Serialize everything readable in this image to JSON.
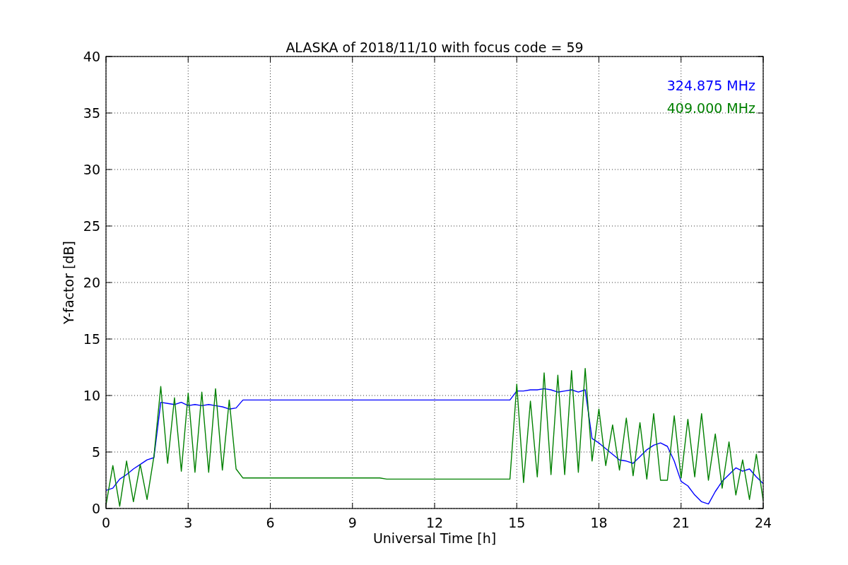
{
  "chart_data": {
    "type": "line",
    "grid": true,
    "title": "ALASKA of 2018/11/10 with focus code = 59",
    "xlabel": "Universal Time [h]",
    "ylabel": "Y-factor [dB]",
    "xlim": [
      0,
      24
    ],
    "ylim": [
      0,
      40
    ],
    "xticks": [
      0,
      3,
      6,
      9,
      12,
      15,
      18,
      21,
      24
    ],
    "yticks": [
      0,
      5,
      10,
      15,
      20,
      25,
      30,
      35,
      40
    ],
    "x": [
      0,
      0.25,
      0.5,
      0.75,
      1,
      1.25,
      1.5,
      1.75,
      2,
      2.25,
      2.5,
      2.75,
      3,
      3.25,
      3.5,
      3.75,
      4,
      4.25,
      4.5,
      4.75,
      5,
      5.25,
      5.5,
      5.75,
      6,
      6.25,
      6.5,
      6.75,
      7,
      7.25,
      7.5,
      7.75,
      8,
      8.25,
      8.5,
      8.75,
      9,
      9.25,
      9.5,
      9.75,
      10,
      10.25,
      10.5,
      10.75,
      11,
      11.25,
      11.5,
      11.75,
      12,
      12.25,
      12.5,
      12.75,
      13,
      13.25,
      13.5,
      13.75,
      14,
      14.25,
      14.5,
      14.75,
      15,
      15.25,
      15.5,
      15.75,
      16,
      16.25,
      16.5,
      16.75,
      17,
      17.25,
      17.5,
      17.75,
      18,
      18.25,
      18.5,
      18.75,
      19,
      19.25,
      19.5,
      19.75,
      20,
      20.25,
      20.5,
      20.75,
      21,
      21.25,
      21.5,
      21.75,
      22,
      22.25,
      22.5,
      22.75,
      23,
      23.25,
      23.5,
      23.75,
      24
    ],
    "series": [
      {
        "name": "324.875 MHz",
        "color": "#0000ff",
        "values": [
          1.6,
          1.8,
          2.6,
          3.0,
          3.5,
          3.9,
          4.3,
          4.5,
          9.4,
          9.3,
          9.2,
          9.4,
          9.1,
          9.2,
          9.1,
          9.2,
          9.1,
          9.0,
          8.8,
          8.9,
          9.6,
          9.6,
          9.6,
          9.6,
          9.6,
          9.6,
          9.6,
          9.6,
          9.6,
          9.6,
          9.6,
          9.6,
          9.6,
          9.6,
          9.6,
          9.6,
          9.6,
          9.6,
          9.6,
          9.6,
          9.6,
          9.6,
          9.6,
          9.6,
          9.6,
          9.6,
          9.6,
          9.6,
          9.6,
          9.6,
          9.6,
          9.6,
          9.6,
          9.6,
          9.6,
          9.6,
          9.6,
          9.6,
          9.6,
          9.6,
          10.4,
          10.4,
          10.5,
          10.5,
          10.6,
          10.5,
          10.3,
          10.4,
          10.5,
          10.3,
          10.5,
          6.2,
          5.8,
          5.3,
          4.8,
          4.3,
          4.2,
          4.0,
          4.6,
          5.2,
          5.6,
          5.8,
          5.5,
          4.2,
          2.4,
          2.0,
          1.2,
          0.6,
          0.4,
          1.5,
          2.4,
          3.0,
          3.6,
          3.3,
          3.5,
          2.8,
          2.2
        ]
      },
      {
        "name": "409.000 MHz",
        "color": "#008000",
        "values": [
          0.3,
          3.8,
          0.2,
          4.2,
          0.6,
          3.9,
          0.8,
          4.6,
          10.8,
          4.0,
          9.8,
          3.3,
          10.2,
          3.2,
          10.3,
          3.2,
          10.6,
          3.4,
          9.6,
          3.5,
          2.7,
          2.7,
          2.7,
          2.7,
          2.7,
          2.7,
          2.7,
          2.7,
          2.7,
          2.7,
          2.7,
          2.7,
          2.7,
          2.7,
          2.7,
          2.7,
          2.7,
          2.7,
          2.7,
          2.7,
          2.7,
          2.6,
          2.6,
          2.6,
          2.6,
          2.6,
          2.6,
          2.6,
          2.6,
          2.6,
          2.6,
          2.6,
          2.6,
          2.6,
          2.6,
          2.6,
          2.6,
          2.6,
          2.6,
          2.6,
          11.0,
          2.3,
          9.5,
          2.8,
          12.0,
          3.0,
          11.8,
          3.0,
          12.2,
          3.2,
          12.4,
          4.2,
          8.8,
          3.8,
          7.4,
          3.4,
          8.0,
          2.9,
          7.6,
          2.6,
          8.4,
          2.5,
          2.5,
          8.2,
          2.7,
          7.9,
          2.8,
          8.4,
          2.5,
          6.6,
          1.8,
          5.9,
          1.2,
          4.3,
          0.8,
          4.8,
          0.7
        ]
      }
    ]
  }
}
